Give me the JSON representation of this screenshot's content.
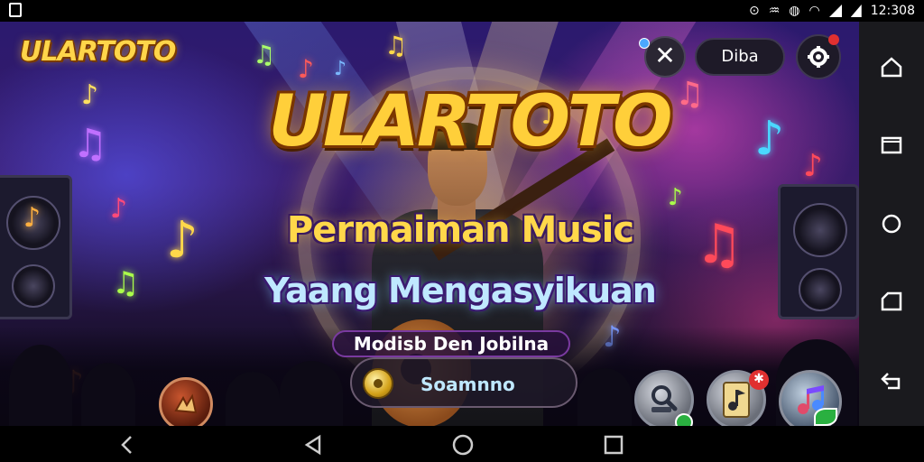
{
  "status_bar": {
    "time": "12:308"
  },
  "game": {
    "brand_logo": "ULARTOTO",
    "hero_title": "ULARTOTO",
    "subtitle_line1": "Permaiman Music",
    "subtitle_line2": "Yaang Mengasyikuan",
    "tagline": "Modisb Den Jobilna",
    "search_pill_label": "Soamnno",
    "top_pill_label": "Diba",
    "close_glyph": "✕"
  },
  "icons": {
    "close": "close-icon",
    "settings": "gear-icon",
    "search_action": "search-icon",
    "music_library": "music-card-icon",
    "music_note": "music-note-icon",
    "left_badge": "guitar-emblem-icon",
    "coin": "coin-icon"
  },
  "nav": {
    "side": [
      "home-icon",
      "window-icon",
      "circle-icon",
      "folder-icon",
      "back-icon"
    ],
    "bottom": [
      "back-chevron-icon",
      "back-triangle-icon",
      "home-circle-icon",
      "recent-square-icon"
    ]
  },
  "colors": {
    "gold": "#ffcf3a",
    "ice_blue": "#bfe8ff",
    "badge_red": "#e03030",
    "badge_green": "#2ab040"
  }
}
